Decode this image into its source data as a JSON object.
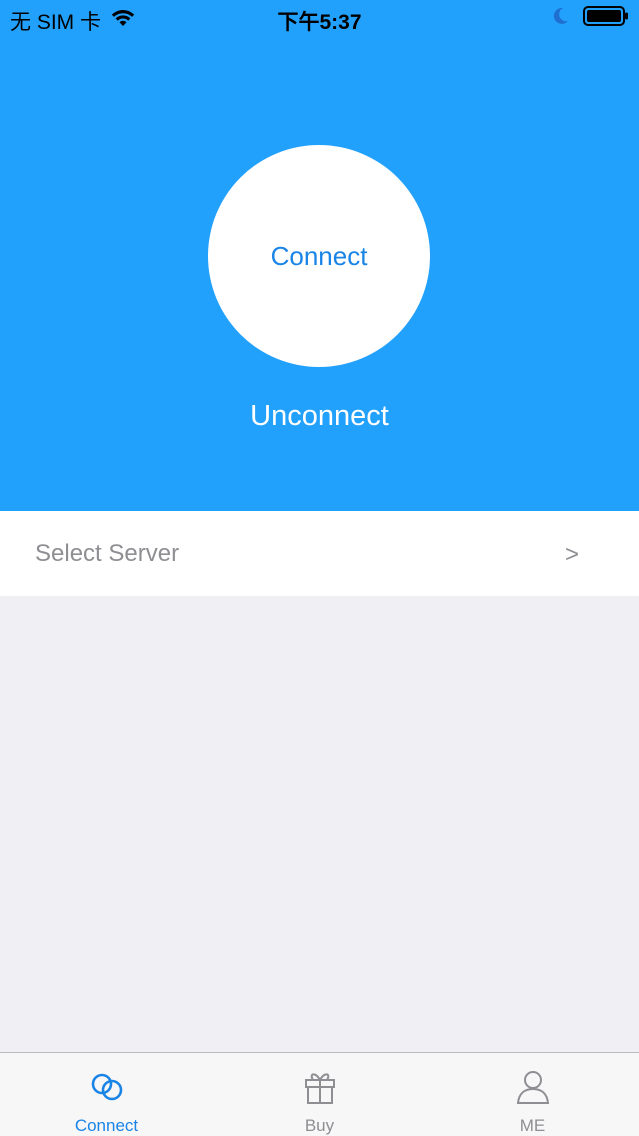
{
  "status_bar": {
    "carrier": "无 SIM 卡",
    "time": "下午5:37"
  },
  "hero": {
    "connect_button_label": "Connect",
    "status_text": "Unconnect"
  },
  "server": {
    "label": "Select Server",
    "chevron": ">"
  },
  "tab_bar": {
    "tabs": [
      {
        "label": "Connect",
        "icon": "link-rings-icon",
        "active": true
      },
      {
        "label": "Buy",
        "icon": "gift-icon",
        "active": false
      },
      {
        "label": "ME",
        "icon": "person-icon",
        "active": false
      }
    ]
  },
  "colors": {
    "accent": "#22a1fc",
    "tab_active": "#1a84e6",
    "tab_inactive": "#8e8e93",
    "background": "#efeff4"
  }
}
